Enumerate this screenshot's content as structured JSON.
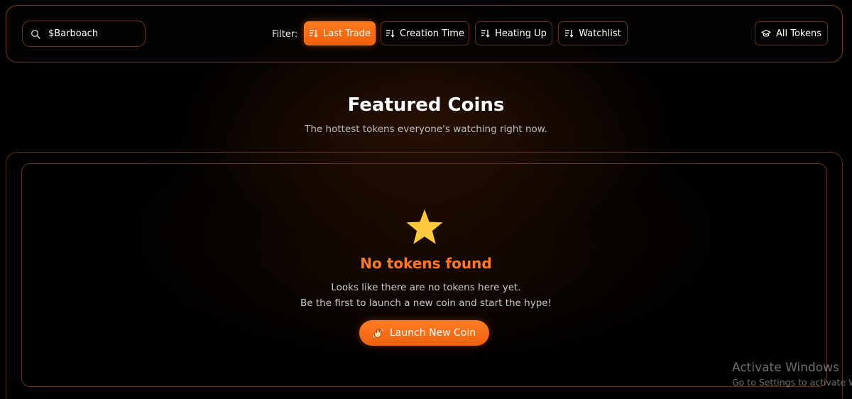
{
  "search": {
    "value": "$Barboach",
    "icon": "search-icon"
  },
  "filter": {
    "label": "Filter:",
    "options": [
      {
        "label": "Last Trade",
        "active": true,
        "icon": "sort-icon"
      },
      {
        "label": "Creation Time",
        "active": false,
        "icon": "sort-icon"
      },
      {
        "label": "Heating Up",
        "active": false,
        "icon": "sort-icon"
      },
      {
        "label": "Watchlist",
        "active": false,
        "icon": "sort-icon"
      }
    ]
  },
  "all_tokens": {
    "label": "All Tokens",
    "icon": "graduation-cap-icon"
  },
  "featured": {
    "title": "Featured Coins",
    "subtitle": "The hottest tokens everyone's watching right now."
  },
  "empty_state": {
    "icon": "star-icon",
    "title": "No tokens found",
    "line1": "Looks like there are no tokens here yet.",
    "line2": "Be the first to launch a new coin and start the hype!",
    "button_label": "Launch New Coin",
    "button_icon": "waving-hand-icon"
  },
  "watermark": {
    "line1": "Activate Windows",
    "line2": "Go to Settings to activate Windows."
  },
  "colors": {
    "accent": "#ff7a1e",
    "border": "#6a3414",
    "star": "#ffc83d",
    "background": "#000000"
  }
}
